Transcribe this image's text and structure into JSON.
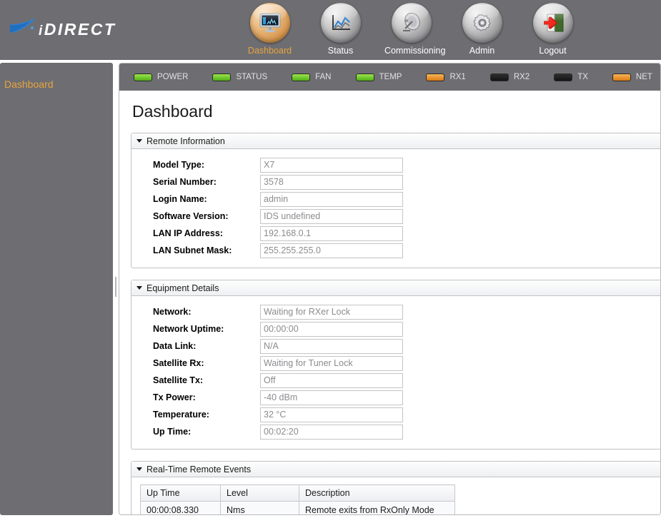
{
  "brand": {
    "name_i": "i",
    "name_rest": "DIRECT"
  },
  "nav": {
    "items": [
      {
        "label": "Dashboard",
        "icon": "monitor-icon",
        "active": true
      },
      {
        "label": "Status",
        "icon": "line-chart-icon",
        "active": false
      },
      {
        "label": "Commissioning",
        "icon": "satellite-dish-icon",
        "active": false
      },
      {
        "label": "Admin",
        "icon": "gear-icon",
        "active": false
      },
      {
        "label": "Logout",
        "icon": "exit-door-icon",
        "active": false
      }
    ]
  },
  "sidebar": {
    "items": [
      {
        "label": "Dashboard"
      }
    ]
  },
  "leds": [
    {
      "label": "POWER",
      "state": "green"
    },
    {
      "label": "STATUS",
      "state": "green"
    },
    {
      "label": "FAN",
      "state": "green"
    },
    {
      "label": "TEMP",
      "state": "green"
    },
    {
      "label": "RX1",
      "state": "orange"
    },
    {
      "label": "RX2",
      "state": "off"
    },
    {
      "label": "TX",
      "state": "off"
    },
    {
      "label": "NET",
      "state": "orange"
    }
  ],
  "page": {
    "title": "Dashboard"
  },
  "remote_information": {
    "title": "Remote Information",
    "fields": [
      {
        "label": "Model Type:",
        "value": "X7"
      },
      {
        "label": "Serial Number:",
        "value": "3578"
      },
      {
        "label": "Login Name:",
        "value": "admin"
      },
      {
        "label": "Software Version:",
        "value": "IDS undefined"
      },
      {
        "label": "LAN IP Address:",
        "value": "192.168.0.1"
      },
      {
        "label": "LAN Subnet Mask:",
        "value": "255.255.255.0"
      }
    ]
  },
  "equipment_details": {
    "title": "Equipment Details",
    "fields": [
      {
        "label": "Network:",
        "value": "Waiting for RXer Lock"
      },
      {
        "label": "Network Uptime:",
        "value": "00:00:00"
      },
      {
        "label": "Data Link:",
        "value": "N/A"
      },
      {
        "label": "Satellite Rx:",
        "value": "Waiting for Tuner Lock"
      },
      {
        "label": "Satellite Tx:",
        "value": "Off"
      },
      {
        "label": "Tx Power:",
        "value": "-40 dBm"
      },
      {
        "label": "Temperature:",
        "value": "32 °C"
      },
      {
        "label": "Up Time:",
        "value": "00:02:20"
      }
    ]
  },
  "real_time_remote_events": {
    "title": "Real-Time Remote Events",
    "columns": [
      "Up Time",
      "Level",
      "Description"
    ],
    "rows": [
      {
        "uptime": "00:00:08.330",
        "level": "Nms",
        "description": "Remote exits from RxOnly Mode"
      }
    ]
  },
  "colors": {
    "banner": "#6e6e72",
    "accent_orange": "#e8a33d",
    "led_green": "#6fc427",
    "led_orange": "#e08b1a",
    "led_off": "#1d1d1d"
  }
}
